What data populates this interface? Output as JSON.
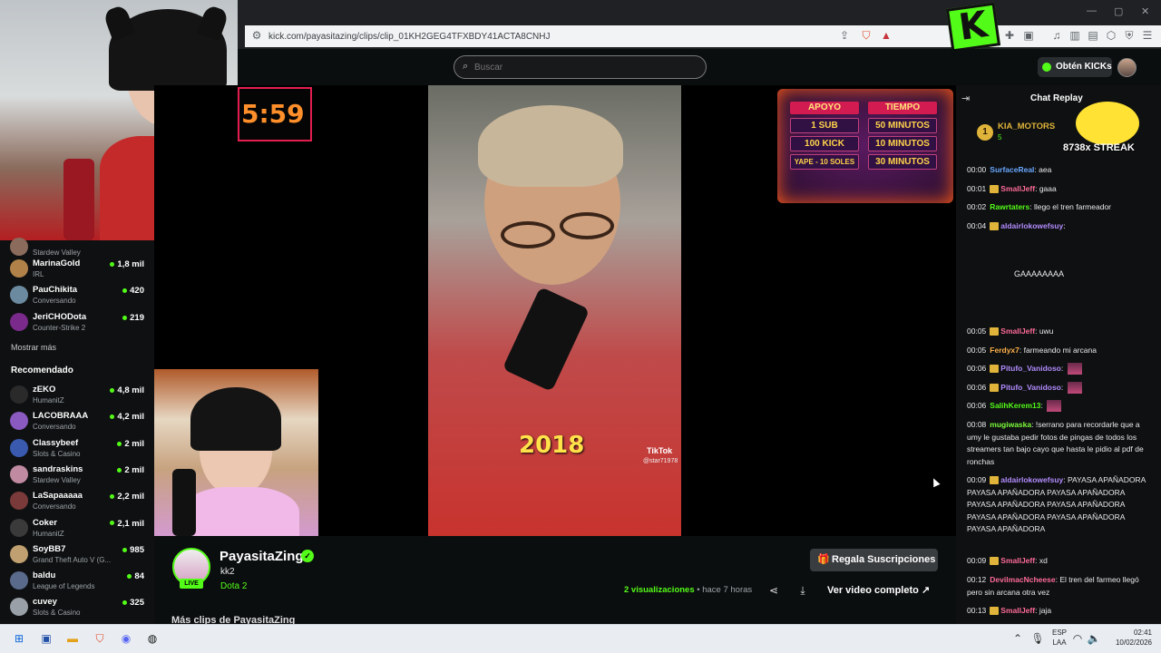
{
  "browser": {
    "url": "kick.com/payasitazing/clips/clip_01KH2GEG4TFXBDY41ACTA8CNHJ",
    "window_controls": [
      "—",
      "▢",
      "✕"
    ]
  },
  "header": {
    "search_placeholder": "Buscar",
    "kicks_button": "Obtén KICKs",
    "logo_letter": "K"
  },
  "sidebar": {
    "channels": [
      {
        "name": "",
        "category": "Stardew Valley",
        "viewers": ""
      },
      {
        "name": "MarinaGold",
        "category": "IRL",
        "viewers": "1,8 mil"
      },
      {
        "name": "PauChikita",
        "category": "Conversando",
        "viewers": "420"
      },
      {
        "name": "JeriCHODota",
        "category": "Counter-Strike 2",
        "viewers": "219"
      }
    ],
    "show_more": "Mostrar más",
    "recommended_title": "Recomendado",
    "recommended": [
      {
        "name": "zEKO",
        "category": "HumanitZ",
        "viewers": "4,8 mil"
      },
      {
        "name": "LACOBRAAA",
        "category": "Conversando",
        "viewers": "4,2 mil"
      },
      {
        "name": "Classybeef",
        "category": "Slots & Casino",
        "viewers": "2 mil"
      },
      {
        "name": "sandraskins",
        "category": "Stardew Valley",
        "viewers": "2 mil"
      },
      {
        "name": "LaSapaaaaa",
        "category": "Conversando",
        "viewers": "2,2 mil"
      },
      {
        "name": "Coker",
        "category": "HumanitZ",
        "viewers": "2,1 mil"
      },
      {
        "name": "SoyBB7",
        "category": "Grand Theft Auto V (G...",
        "viewers": "985"
      },
      {
        "name": "baldu",
        "category": "League of Legends",
        "viewers": "84"
      },
      {
        "name": "cuvey",
        "category": "Slots & Casino",
        "viewers": "325"
      }
    ]
  },
  "video": {
    "timer": "5:59",
    "year_caption": "2018",
    "tiktok_label": "TikTok",
    "tiktok_user": "@star71978",
    "price_card": {
      "headers": [
        "APOYO",
        "TIEMPO"
      ],
      "rows": [
        [
          "1 SUB",
          "50 MINUTOS"
        ],
        [
          "100 KICK",
          "10 MINUTOS"
        ],
        [
          "YAPE - 10 SOLES",
          "30 MINUTOS"
        ]
      ]
    }
  },
  "clip_info": {
    "streamer": "PayasitaZing",
    "live_badge": "LIVE",
    "title": "kk2",
    "category": "Dota 2",
    "subscribe_button": "Regala Suscripciones",
    "views_count": "2 visualizaciones",
    "time_ago": "• hace 7 horas",
    "full_video_button": "Ver video completo",
    "more_clips": "Más clips de PayasitaZing"
  },
  "chat": {
    "title": "Chat Replay",
    "pinned": {
      "name": "KIA_MOTORS",
      "sub": "5",
      "rank": "1"
    },
    "streak": "8738x STREAK",
    "messages": [
      {
        "time": "00:00",
        "user": "SurfaceReal",
        "color": "#6aa8ff",
        "text": "aea"
      },
      {
        "time": "00:01",
        "user": "SmallJeff",
        "color": "#ff6b9a",
        "text": "gaaa"
      },
      {
        "time": "00:02",
        "user": "Rawrtaters",
        "color": "#53fc18",
        "text": "llego el tren farmeador"
      },
      {
        "time": "00:04",
        "user": "aldairlokowefsuy",
        "color": "#b38cff",
        "text": ""
      },
      {
        "time": "00:05",
        "user": "SmallJeff",
        "color": "#ff6b9a",
        "text": "uwu"
      },
      {
        "time": "00:05",
        "user": "Ferdyx7",
        "color": "#ffb14a",
        "text": "farmeando mi arcana"
      },
      {
        "time": "00:06",
        "user": "Pitufo_Vanidoso",
        "color": "#b38cff",
        "text": ""
      },
      {
        "time": "00:06",
        "user": "Pitufo_Vanidoso",
        "color": "#b38cff",
        "text": ""
      },
      {
        "time": "00:06",
        "user": "SalihKerem13",
        "color": "#53fc18",
        "text": ""
      },
      {
        "time": "00:08",
        "user": "mugiwaska",
        "color": "#7dfc3a",
        "text": "!serrano para recordarle que a umy le gustaba pedir fotos de pingas de todos los streamers tan bajo cayo que hasta le pidio al pdf de ronchas"
      },
      {
        "time": "00:09",
        "user": "aldairlokowefsuy",
        "color": "#b38cff",
        "text": "PAYASA APAÑADORA PAYASA APAÑADORA PAYASA APAÑADORA PAYASA APAÑADORA PAYASA APAÑADORA PAYASA APAÑADORA PAYASA APAÑADORA PAYASA APAÑADORA"
      },
      {
        "time": "00:09",
        "user": "SmallJeff",
        "color": "#ff6b9a",
        "text": "xd"
      },
      {
        "time": "00:12",
        "user": "DevilmacNcheese",
        "color": "#ff6b9a",
        "text": "El tren del farmeo llegó  pero sin arcana otra vez"
      },
      {
        "time": "00:13",
        "user": "SmallJeff",
        "color": "#ff6b9a",
        "text": "jaja"
      }
    ],
    "big_emote_text": "GAAAAAAAA"
  },
  "taskbar": {
    "lang_top": "ESP",
    "lang_bottom": "LAA",
    "time": "02:41",
    "date": "10/02/2026"
  }
}
